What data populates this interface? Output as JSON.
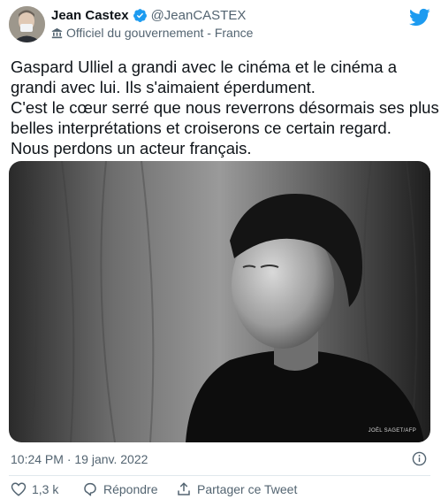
{
  "author": {
    "display_name": "Jean Castex",
    "handle": "@JeanCASTEX",
    "label": "Officiel du gouvernement - France",
    "avatar_icon": "author-avatar",
    "verified_icon": "verified-badge-icon"
  },
  "tweet": {
    "lines": [
      "Gaspard Ulliel a grandi avec le cinéma et le cinéma a",
      "grandi avec lui. Ils s'aimaient éperdument.",
      "C'est le cœur serré que nous reverrons désormais ses plus",
      "belles interprétations et croiserons ce certain regard.",
      "Nous perdons un acteur français."
    ],
    "photo_credit": "JOËL SAGET/AFP",
    "timestamp": "10:24 PM · 19 janv. 2022"
  },
  "actions": {
    "like_count": "1,3 k",
    "reply_label": "Répondre",
    "share_label": "Partager ce Tweet"
  },
  "colors": {
    "brand": "#1d9bf0",
    "text": "#0f1419",
    "secondary": "#536471"
  }
}
